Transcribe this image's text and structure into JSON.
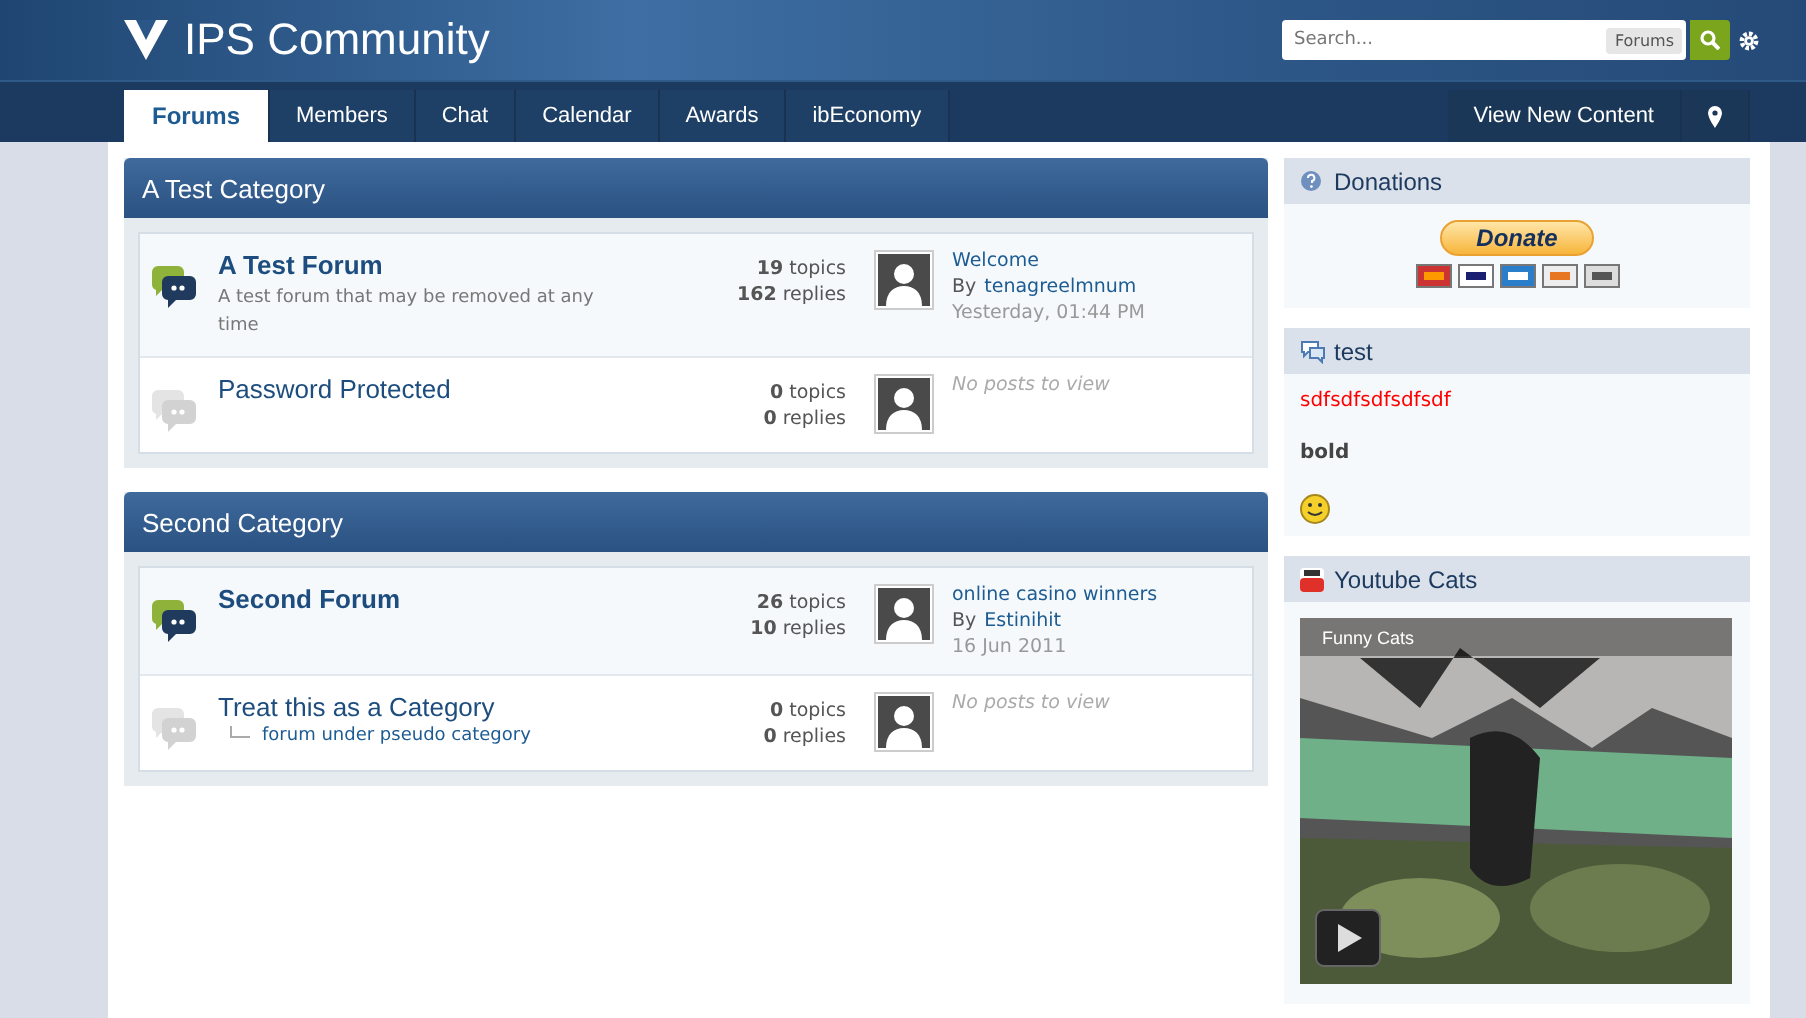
{
  "header": {
    "logo_text": "IPS Community",
    "search": {
      "placeholder": "Search...",
      "scope": "Forums"
    }
  },
  "nav": {
    "tabs": [
      {
        "label": "Forums",
        "selected": true
      },
      {
        "label": "Members",
        "selected": false
      },
      {
        "label": "Chat",
        "selected": false
      },
      {
        "label": "Calendar",
        "selected": false
      },
      {
        "label": "Awards",
        "selected": false
      },
      {
        "label": "ibEconomy",
        "selected": false
      }
    ],
    "right_link": "View New Content"
  },
  "categories": [
    {
      "title": "A Test Category",
      "forums": [
        {
          "name": "A Test Forum",
          "unread": true,
          "description": "A test forum that may be removed at any time",
          "topics": "**19** topics",
          "replies": "**162** replies",
          "last_post": {
            "title": "Welcome",
            "by": "By",
            "author": "tenagreelmnum",
            "date": "Yesterday, 01:44 PM"
          }
        },
        {
          "name": "Password Protected",
          "unread": false,
          "topics": "**0** topics",
          "replies": "**0** replies",
          "no_posts": "No posts to view"
        }
      ]
    },
    {
      "title": "Second Category",
      "forums": [
        {
          "name": "Second Forum",
          "unread": true,
          "topics": "**26** topics",
          "replies": "**10** replies",
          "last_post": {
            "title": "online casino winners",
            "by": "By",
            "author": "Estinihit",
            "date": "16 Jun 2011"
          }
        },
        {
          "name": "Treat this as a Category",
          "unread": false,
          "subforums": [
            "forum under pseudo category"
          ],
          "topics": "**0** topics",
          "replies": "**0** replies",
          "no_posts": "No posts to view"
        }
      ]
    }
  ],
  "sidebar": [
    {
      "kind": "donations",
      "title": "Donations",
      "button": "Donate"
    },
    {
      "kind": "html",
      "title": "test",
      "lines": [
        {
          "kind": "red",
          "text": "sdfsdfsdfsdfsdf"
        },
        {
          "kind": "bold",
          "text": "bold"
        },
        {
          "kind": "smiley"
        }
      ]
    },
    {
      "kind": "video",
      "title": "Youtube Cats",
      "video_title": "Funny Cats"
    }
  ]
}
